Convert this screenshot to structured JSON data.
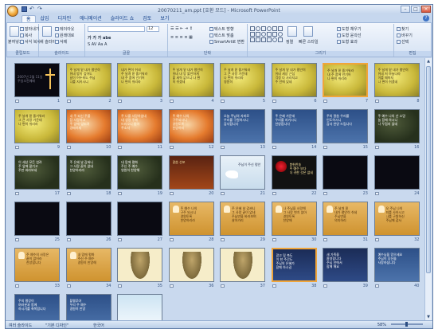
{
  "window": {
    "title": "20070211_am.ppt [호환 모드] - Microsoft PowerPoint",
    "controls": [
      "minimize",
      "maximize",
      "close"
    ]
  },
  "quick_access": [
    "save-icon",
    "undo-icon",
    "redo-icon"
  ],
  "tabs": [
    "홈",
    "삽입",
    "디자인",
    "애니메이션",
    "슬라이드 쇼",
    "검토",
    "보기"
  ],
  "active_tab": "홈",
  "ribbon": {
    "clipboard": {
      "label": "클립보드",
      "paste": "붙여넣기",
      "cut": "잘라내기",
      "copy": "복사",
      "format": "서식 복사"
    },
    "slides": {
      "label": "슬라이드",
      "new_slide": "새 슬라이드",
      "layout": "레이아웃",
      "reset": "원래대로",
      "delete": "삭제"
    },
    "font": {
      "label": "글꼴",
      "font_size": "12"
    },
    "paragraph": {
      "label": "단락",
      "text_direction": "텍스트 방향",
      "align_text": "텍스트 맞춤",
      "smartart": "SmartArt로 변환"
    },
    "drawing": {
      "label": "그리기",
      "arrange": "정렬",
      "quick_styles": "빠른 스타일",
      "fill": "도형 채우기",
      "outline": "도형 윤곽선",
      "effects": "도형 효과"
    },
    "editing": {
      "label": "편집",
      "find": "찾기",
      "replace": "바꾸기",
      "select": "선택"
    }
  },
  "slides": [
    {
      "n": "1",
      "theme": "black",
      "text": "2007년 2월 11일\n주일오전예배",
      "sel": false,
      "fig": "cross"
    },
    {
      "n": "2",
      "theme": "yellow",
      "text": "주 날개 밑 내가 평안히\n쉬네 밤이 깊어도\n날이 어두워도 주님\n나를 지키시니",
      "sel": false
    },
    {
      "n": "3",
      "theme": "yellow",
      "text": "내가 편히 쉬네\n주 날개 밑 즐거워라\n내 주 품에 안기어\n나 편히 쉬리라",
      "sel": false
    },
    {
      "n": "4",
      "theme": "yellow",
      "text": "주 날개 밑 내가 평안히\n쉬네 내 맘 불안하게\n할 세력 없으니 나 편\n히 쉬겠네",
      "sel": false
    },
    {
      "n": "5",
      "theme": "yellow",
      "text": "주 날개 밑 즐거워라\n그 큰 사랑 가운데\n나 편히 쉬리라\n영원히",
      "sel": false
    },
    {
      "n": "6",
      "theme": "yellow",
      "text": "주 날개 밑 내가 평안히\n쉬네 세상 근심\n걱정 다 사라지고\n주 안에 있네",
      "sel": false
    },
    {
      "n": "7",
      "theme": "yellow",
      "text": "주 날개 밑 즐거워라\n내 주 품에 안기어\n나 편히 쉬리라",
      "sel": true
    },
    {
      "n": "8",
      "theme": "yellow",
      "text": "주 날개 밑 내가 평안히\n쉬네 저 하늘나라\n이를 때까지\n나 편히 쉬겠네",
      "sel": false
    },
    {
      "n": "9",
      "theme": "yellow",
      "text": "주 날개 밑 즐거워라\n그 큰 사랑 가운데\n나 편히 쉬리라",
      "sel": false
    },
    {
      "n": "10",
      "theme": "orange",
      "text": "내 주 되신 주를\n참 사랑하고\n주 앞에 엎드려\n경배하세",
      "sel": false
    },
    {
      "n": "11",
      "theme": "orange",
      "text": "주 나를 사랑하셨네\n내 생명 주께\n드리오니 받아\n주소서",
      "sel": false
    },
    {
      "n": "12",
      "theme": "orange",
      "text": "주 예수 나의\n구주되시니\n영원토록\n찬양하리",
      "sel": false
    },
    {
      "n": "13",
      "theme": "blue",
      "text": "오늘 주님의 자비로\n우리를 구원하시니\n감사합니다",
      "sel": false
    },
    {
      "n": "14",
      "theme": "blue",
      "text": "주 은혜 가운데\n우리를 지키시니\n찬양합니다",
      "sel": false
    },
    {
      "n": "15",
      "theme": "blue",
      "text": "주의 말씀 우리를\n인도하시니\n감사 찬양 드립니다",
      "sel": false
    },
    {
      "n": "16",
      "theme": "green",
      "text": "주 예수 나의 산 소망\n늘 함께 하시니\n나 두렵지 않네",
      "sel": false
    },
    {
      "n": "17",
      "theme": "green",
      "text": "이 세상 모든 염려\n주 앞에 맡기고\n주만 바라보네",
      "sel": false
    },
    {
      "n": "18",
      "theme": "green",
      "text": "주 은혜 날 감싸니\n그 사랑 끝이 없네\n찬양하리라",
      "sel": false
    },
    {
      "n": "19",
      "theme": "green",
      "text": "내 맘에 평화\n주신 주 예수\n영원히 찬양해",
      "sel": false
    },
    {
      "n": "20",
      "theme": "dkred",
      "text": "말씀 선포",
      "sel": false
    },
    {
      "n": "21",
      "theme": "white",
      "text": "주님이 주신 평안",
      "sel": false,
      "fig": "dove"
    },
    {
      "n": "22",
      "theme": "blkred",
      "text": "봉헌찬송\n주 예수 보다\n더 귀한 것은 없네",
      "sel": false,
      "fig": "rose"
    },
    {
      "n": "23",
      "theme": "black",
      "text": "",
      "sel": false
    },
    {
      "n": "24",
      "theme": "black",
      "text": "",
      "sel": false
    },
    {
      "n": "25",
      "theme": "black",
      "text": "",
      "sel": false
    },
    {
      "n": "26",
      "theme": "black",
      "text": "",
      "sel": false
    },
    {
      "n": "27",
      "theme": "black",
      "text": "",
      "sel": false
    },
    {
      "n": "28",
      "theme": "tan",
      "text": "주 예수 나의\n구주 되시니\n영원토록\n찬양하리라",
      "sel": false,
      "fig": "hand"
    },
    {
      "n": "29",
      "theme": "tan",
      "text": "주 은혜 날 감싸니\n그 사랑 끝이 없네\n주님만을 바라보며\n살아가리",
      "sel": false,
      "fig": "hand"
    },
    {
      "n": "30",
      "theme": "tan",
      "text": "나 주님을 사랑해\n그 사랑 변치 않아\n영원토록\n찬양해",
      "sel": false,
      "fig": "hand"
    },
    {
      "n": "31",
      "theme": "tan",
      "text": "주 날개 밑\n내가 평안히 쉬네\n주님만을\n의지하리",
      "sel": false,
      "fig": "hand"
    },
    {
      "n": "32",
      "theme": "tan",
      "text": "오 주님 나의\n죄를 사하시고\n나를 구원하신\n주님께 감사",
      "sel": false,
      "fig": "hand"
    },
    {
      "n": "33",
      "theme": "tan",
      "text": "주 예수의 사랑은\n끝이 없어라\n찬양합니다",
      "sel": false,
      "fig": "hand"
    },
    {
      "n": "34",
      "theme": "tan",
      "text": "내 맘에 평화\n주신 주 예수\n영원히 찬양해",
      "sel": false,
      "fig": "hand"
    },
    {
      "n": "35",
      "theme": "paper",
      "text": "",
      "sel": false,
      "fig": "jesus"
    },
    {
      "n": "36",
      "theme": "paper",
      "text": "",
      "sel": false,
      "fig": "jesus"
    },
    {
      "n": "37",
      "theme": "paper",
      "text": "",
      "sel": false,
      "fig": "jesus"
    },
    {
      "n": "38",
      "theme": "navy",
      "text": "광고 및 축도\n이 한 주간도\n주님의 은혜가\n함께 하시길",
      "sel": true
    },
    {
      "n": "39",
      "theme": "navy",
      "text": "새 가족을\n환영합니다\n주님 안에서\n함께 해요",
      "sel": false
    },
    {
      "n": "40",
      "theme": "blue",
      "text": "예수님을 믿으세요\n주님이 당신을\n사랑하십니다",
      "sel": false
    },
    {
      "n": "41",
      "theme": "blue",
      "text": "주의 평강이\n여러분과 함께\n하시기를 축복합니다",
      "sel": false
    },
    {
      "n": "42",
      "theme": "blue",
      "text": "할렐루야\n우리 주 예수\n영원히 찬양",
      "sel": false
    },
    {
      "n": "43",
      "theme": "sky",
      "text": "",
      "sel": false
    }
  ],
  "status": {
    "view": "여러 슬라이드",
    "theme": "\"기본 디자인\"",
    "language": "한국어",
    "zoom": "58%"
  }
}
